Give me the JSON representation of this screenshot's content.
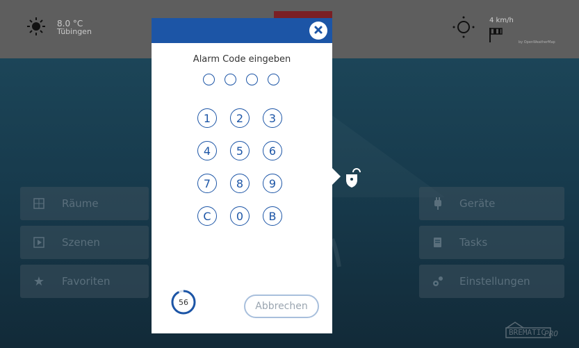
{
  "weather": {
    "temperature": "8.0 °C",
    "city": "Tübingen",
    "icon": "sun-icon"
  },
  "wind": {
    "speed": "4 km/h",
    "credit": "by OpenWeatherMap",
    "icon": "windsock-icon"
  },
  "tiles": {
    "rooms": "Räume",
    "scenes": "Szenen",
    "favorites": "Favoriten",
    "devices": "Geräte",
    "tasks": "Tasks",
    "settings": "Einstellungen"
  },
  "dialog": {
    "prompt": "Alarm Code eingeben",
    "keys": [
      "1",
      "2",
      "3",
      "4",
      "5",
      "6",
      "7",
      "8",
      "9",
      "C",
      "0",
      "B"
    ],
    "countdown": "56",
    "countdown_fraction": 0.93,
    "cancel_label": "Abbrechen"
  },
  "logo": {
    "name": "BREMATIC",
    "sub": "PRO"
  },
  "colors": {
    "accent": "#1c55a6",
    "topbar": "#5e5e5e",
    "background": "#173a4c"
  }
}
